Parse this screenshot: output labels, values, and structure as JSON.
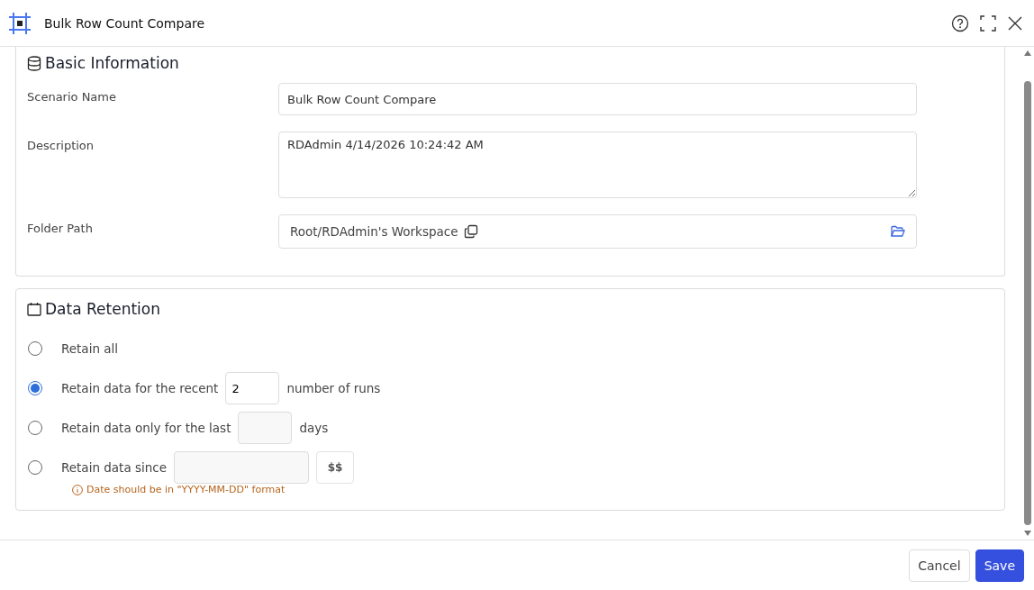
{
  "window": {
    "title": "Bulk Row Count Compare"
  },
  "basic_information": {
    "title": "Basic Information",
    "fields": [
      {
        "kind": "input",
        "label": "Scenario Name",
        "value": "Bulk Row Count Compare"
      },
      {
        "kind": "textarea",
        "label": "Description",
        "value": "RDAdmin 4/14/2026 10:24:42 AM"
      },
      {
        "kind": "path",
        "label": "Folder Path",
        "value": "Root/RDAdmin's Workspace"
      }
    ]
  },
  "data_retention": {
    "title": "Data Retention",
    "options": [
      {
        "kind": "plain",
        "label": "Retain all",
        "selected": false
      },
      {
        "kind": "count",
        "label": "Retain data for the recent",
        "value": "2",
        "suffix": "number of runs",
        "selected": true
      },
      {
        "kind": "count",
        "label": "Retain data only for the last",
        "suffix": "days",
        "selected": false
      },
      {
        "kind": "date",
        "label": "Retain data since",
        "button": "$$",
        "hint": "Date should be in \"YYYY-MM-DD\" format",
        "selected": false
      }
    ]
  },
  "buttons": [
    "Cancel",
    "Save"
  ]
}
